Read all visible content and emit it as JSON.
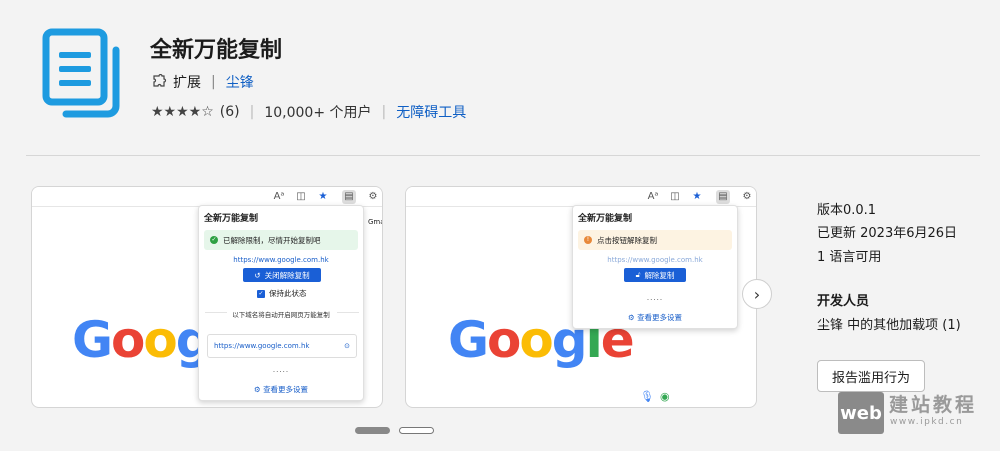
{
  "header": {
    "title": "全新万能复制",
    "category": "扩展",
    "separator": "|",
    "author": "尘锋",
    "stars": "★★★★☆",
    "rating_count": "(6)",
    "users": "10,000+ 个用户",
    "accessibility_link": "无障碍工具"
  },
  "screenshot1": {
    "popup_title": "全新万能复制",
    "banner_text": "已解除限制，尽情开始复制吧",
    "url": "https://www.google.com.hk",
    "button_label": "关闭解除复制",
    "checkbox_label": "保持此状态",
    "hint": "以下域名将自动开启网页万能复制",
    "domain": "https://www.google.com.hk",
    "dots": ".....",
    "more_settings": "查看更多设置",
    "side_text": "Gma",
    "logo": [
      "G",
      "o",
      "o",
      "g",
      "l"
    ]
  },
  "screenshot2": {
    "popup_title": "全新万能复制",
    "banner_text": "点击按钮解除复制",
    "url": "https://www.google.com.hk",
    "button_label": "解除复制",
    "dots": ".....",
    "more_settings": "查看更多设置",
    "logo": [
      "G",
      "o",
      "o",
      "g",
      "l",
      "e"
    ]
  },
  "info": {
    "version": "版本0.0.1",
    "updated": "已更新 2023年6月26日",
    "languages": "1 语言可用",
    "developer_heading": "开发人员",
    "developer_link": "尘锋 中的其他加载项 (1)",
    "report_button": "报告滥用行为"
  },
  "watermark": {
    "box_text": "web",
    "title": "建站教程",
    "url": "www.ipkd.cn"
  },
  "colors": {
    "accent": "#0f5fc4",
    "icon_blue": "#1e9be0",
    "google_blue": "#4285f4",
    "google_red": "#ea4335",
    "google_yellow": "#fbbc05",
    "google_green": "#34a853"
  }
}
